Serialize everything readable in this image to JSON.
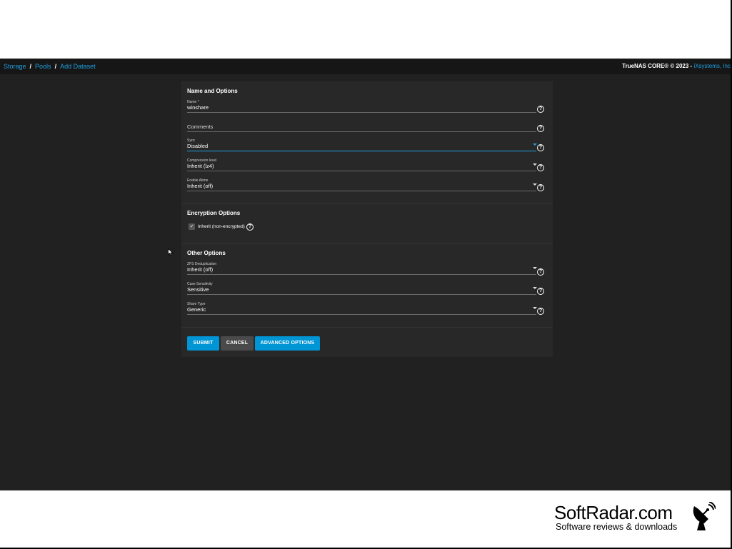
{
  "breadcrumb": [
    "Storage",
    "Pools",
    "Add Dataset"
  ],
  "breadcrumb_separator": "/",
  "copyright": {
    "text": "TrueNAS CORE® © 2023 - ",
    "vendor": "iXsystems, Inc"
  },
  "sections": {
    "name_options": "Name and Options",
    "encryption": "Encryption Options",
    "other": "Other Options"
  },
  "fields": {
    "name": {
      "label": "Name *",
      "value": "winshare"
    },
    "comments": {
      "label": "",
      "value": "Comments"
    },
    "sync": {
      "label": "Sync",
      "value": "Disabled"
    },
    "compression": {
      "label": "Compression level",
      "value": "Inherit (lz4)"
    },
    "atime": {
      "label": "Enable Atime",
      "value": "Inherit (off)"
    },
    "dedup": {
      "label": "ZFS Deduplication",
      "value": "Inherit (off)"
    },
    "case": {
      "label": "Case Sensitivity",
      "value": "Sensitive"
    },
    "share": {
      "label": "Share Type",
      "value": "Generic"
    }
  },
  "encryption": {
    "label": "Inherit (non-encrypted)",
    "checked": true,
    "check_glyph": "✓"
  },
  "help_glyph": "?",
  "buttons": {
    "submit": "SUBMIT",
    "cancel": "CANCEL",
    "advanced": "ADVANCED OPTIONS"
  },
  "watermark": {
    "title": "SoftRadar.com",
    "tagline": "Software reviews & downloads"
  },
  "colors": {
    "accent": "#0095d5",
    "link": "#1ea0e0",
    "background": "#212121",
    "card": "#282828"
  }
}
